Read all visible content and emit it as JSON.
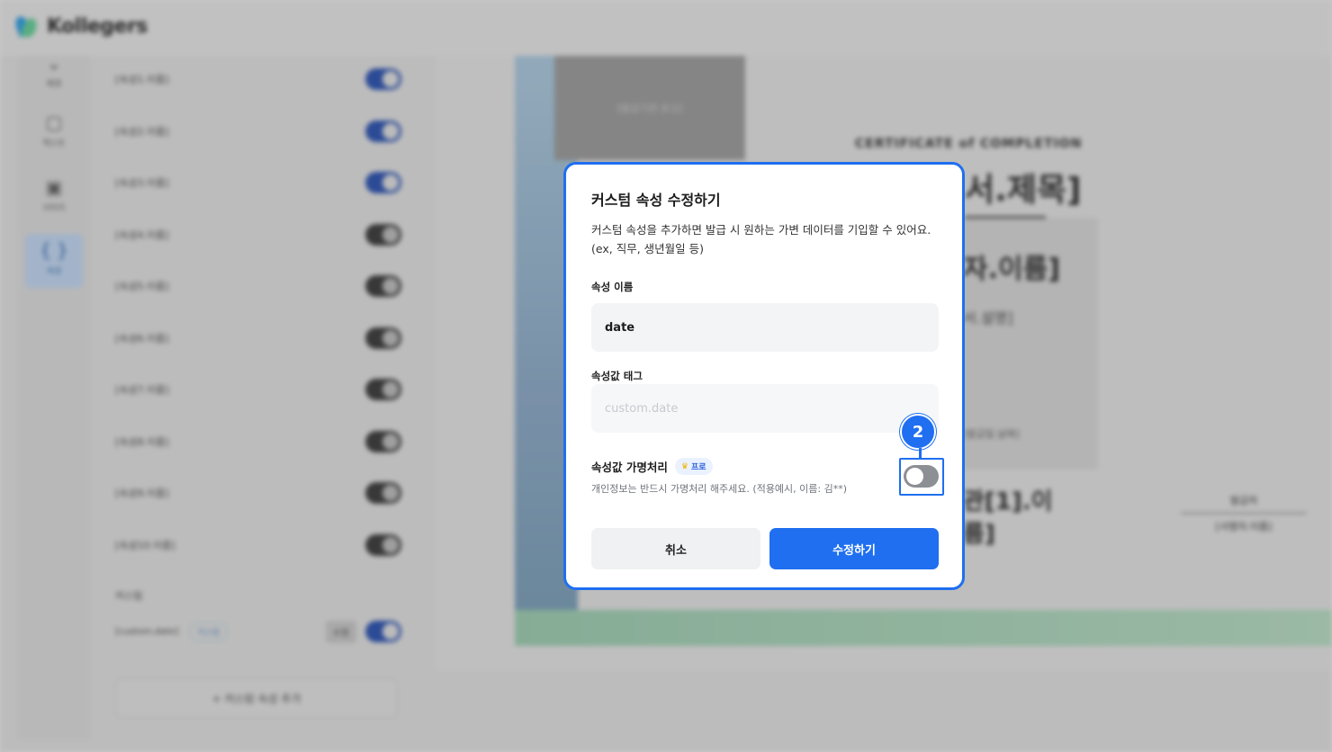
{
  "app": {
    "logo_text": "Kollegers"
  },
  "rail": [
    {
      "label": "배경",
      "icon": "chevron-icon"
    },
    {
      "label": "텍스트",
      "icon": "text-icon"
    },
    {
      "label": "이미지",
      "icon": "image-icon"
    },
    {
      "label": "속성",
      "icon": "braces-icon"
    }
  ],
  "panel": {
    "rows": [
      {
        "label": "[속성1.이름]",
        "on": true
      },
      {
        "label": "[속성2.이름]",
        "on": true
      },
      {
        "label": "[속성3.이름]",
        "on": true
      },
      {
        "label": "[속성4.이름]",
        "on": false
      },
      {
        "label": "[속성5.이름]",
        "on": false
      },
      {
        "label": "[속성6.이름]",
        "on": false
      },
      {
        "label": "[속성7.이름]",
        "on": false
      },
      {
        "label": "[속성8.이름]",
        "on": false
      },
      {
        "label": "[속성9.이름]",
        "on": false
      },
      {
        "label": "[속성10.이름]",
        "on": false
      }
    ],
    "section_label": "커스텀",
    "custom_row": {
      "label": "[custom.date]",
      "pill": "커스텀",
      "button": "수정"
    },
    "add_button": "+ 커스텀 속성 추가"
  },
  "certificate": {
    "image_label": "[발급기관.로고]",
    "subtitle": "CERTIFICATE of COMPLETION",
    "title": "서.제목]",
    "name": "자.이름]",
    "desc": "서.설명]",
    "small": "[발급일.날짜]",
    "org": "관[1].이\n름]",
    "sig_title": "발급처",
    "sig_name": "[서명자.이름]"
  },
  "modal": {
    "title": "커스텀 속성 수정하기",
    "description": "커스텀 속성을 추가하면 발급 시 원하는 가변 데이터를 기입할 수 있어요. (ex, 직무, 생년월일 등)",
    "name_label": "속성 이름",
    "name_value": "date",
    "tag_label": "속성값 태그",
    "tag_placeholder": "custom.date",
    "anon_title": "속성값 가명처리",
    "pro_label": "프로",
    "anon_help": "개인정보는 반드시 가명처리 해주세요. (적용예시, 이름: 김**)",
    "anon_enabled": false,
    "step_number": "2",
    "cancel_label": "취소",
    "submit_label": "수정하기"
  },
  "colors": {
    "accent": "#1f6ff0",
    "toggle_off": "#8c8f93"
  }
}
